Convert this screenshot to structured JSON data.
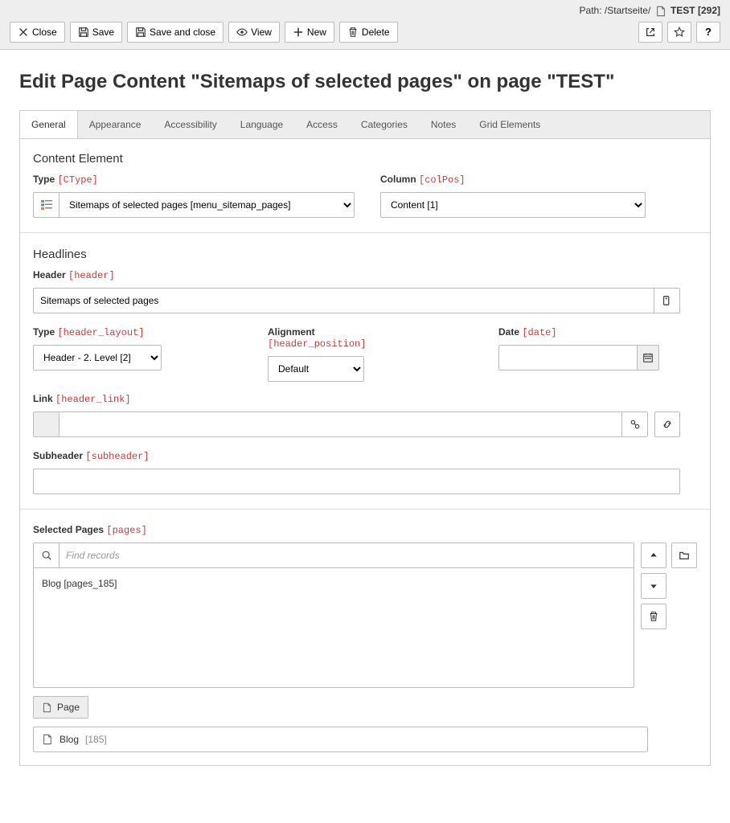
{
  "path": {
    "label": "Path:",
    "segments": "/Startseite/",
    "pageName": "TEST",
    "pageId": "[292]"
  },
  "toolbar": {
    "close": "Close",
    "save": "Save",
    "saveClose": "Save and close",
    "view": "View",
    "new": "New",
    "delete": "Delete"
  },
  "title": "Edit Page Content \"Sitemaps of selected pages\" on page \"TEST\"",
  "tabs": [
    "General",
    "Appearance",
    "Accessibility",
    "Language",
    "Access",
    "Categories",
    "Notes",
    "Grid Elements"
  ],
  "sections": {
    "contentElement": "Content Element",
    "headlines": "Headlines"
  },
  "fields": {
    "type": {
      "label": "Type",
      "name": "[CType]",
      "value": "Sitemaps of selected pages [menu_sitemap_pages]"
    },
    "column": {
      "label": "Column",
      "name": "[colPos]",
      "value": "Content [1]"
    },
    "header": {
      "label": "Header",
      "name": "[header]",
      "value": "Sitemaps of selected pages"
    },
    "headerLayout": {
      "label": "Type",
      "name": "[header_layout]",
      "value": "Header - 2. Level [2]"
    },
    "alignment": {
      "label": "Alignment",
      "name": "[header_position]",
      "value": "Default"
    },
    "date": {
      "label": "Date",
      "name": "[date]",
      "value": ""
    },
    "link": {
      "label": "Link",
      "name": "[header_link]",
      "value": ""
    },
    "subheader": {
      "label": "Subheader",
      "name": "[subheader]",
      "value": ""
    },
    "pages": {
      "label": "Selected Pages",
      "name": "[pages]",
      "findPlaceholder": "Find records",
      "items": [
        "Blog [pages_185]"
      ],
      "chip": "Page",
      "ref": {
        "title": "Blog",
        "id": "[185]"
      }
    }
  }
}
